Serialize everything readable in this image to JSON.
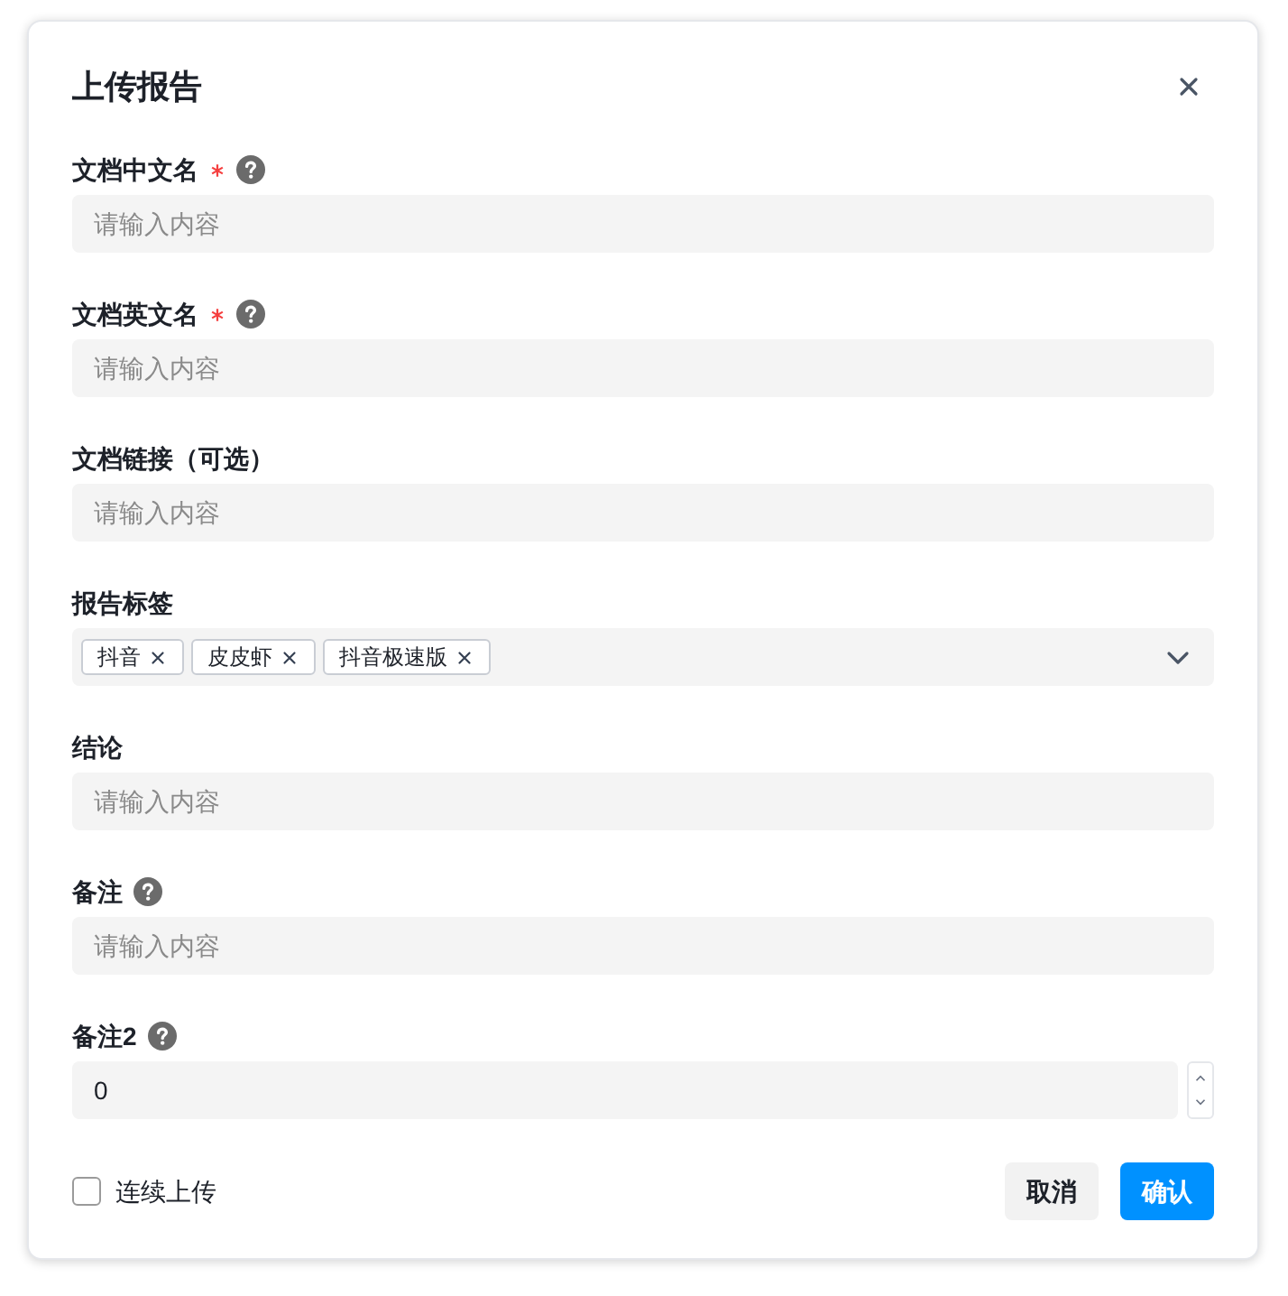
{
  "dialog": {
    "title": "上传报告"
  },
  "fields": [
    {
      "kind": "text",
      "label": "文档中文名",
      "required": true,
      "help": true,
      "placeholder": "请输入内容"
    },
    {
      "kind": "text",
      "label": "文档英文名",
      "required": true,
      "help": true,
      "placeholder": "请输入内容"
    },
    {
      "kind": "text",
      "label": "文档链接（可选）",
      "required": false,
      "help": false,
      "placeholder": "请输入内容"
    },
    {
      "kind": "tags",
      "label": "报告标签",
      "required": false,
      "help": false,
      "tags": [
        "抖音",
        "皮皮虾",
        "抖音极速版"
      ]
    },
    {
      "kind": "text",
      "label": "结论",
      "required": false,
      "help": false,
      "placeholder": "请输入内容"
    },
    {
      "kind": "text",
      "label": "备注",
      "required": false,
      "help": true,
      "placeholder": "请输入内容"
    },
    {
      "kind": "number",
      "label": "备注2",
      "required": false,
      "help": true,
      "value": "0"
    }
  ],
  "continuous_upload": {
    "label": "连续上传",
    "checked": false
  },
  "buttons": [
    {
      "label": "取消",
      "kind": "secondary"
    },
    {
      "label": "确认",
      "kind": "primary"
    }
  ]
}
